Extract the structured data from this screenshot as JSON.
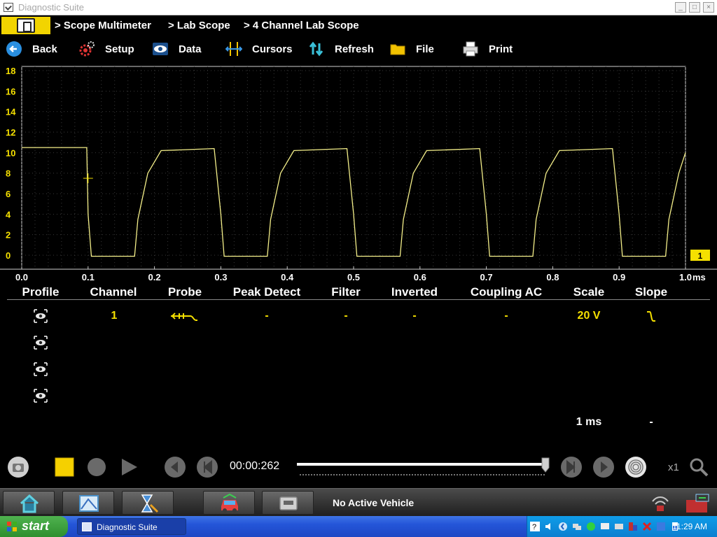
{
  "window": {
    "title": "Diagnostic Suite"
  },
  "breadcrumb": {
    "items": [
      "> Scope Multimeter",
      "> Lab Scope",
      "> 4 Channel Lab Scope"
    ]
  },
  "toolbar": {
    "back": "Back",
    "setup": "Setup",
    "data": "Data",
    "cursors": "Cursors",
    "refresh": "Refresh",
    "file": "File",
    "print": "Print"
  },
  "scope": {
    "y_ticks": [
      "18",
      "16",
      "14",
      "12",
      "10",
      "8",
      "6",
      "4",
      "2",
      "0"
    ],
    "x_ticks": [
      "0.0",
      "0.1",
      "0.2",
      "0.3",
      "0.4",
      "0.5",
      "0.6",
      "0.7",
      "0.8",
      "0.9",
      "1.0"
    ],
    "x_unit": "ms",
    "channel_marker": "1",
    "trace_color": "#f5f08a",
    "marker_color": "#f5e000"
  },
  "chart_data": {
    "type": "line",
    "title": "",
    "xlabel": "ms",
    "ylabel": "",
    "xlim": [
      0,
      1.0
    ],
    "ylim": [
      -1.5,
      18
    ],
    "grid": true,
    "series": [
      {
        "x": [
          0.0,
          0.098,
          0.1,
          0.105,
          0.17,
          0.175,
          0.19,
          0.21,
          0.29,
          0.3,
          0.305,
          0.37,
          0.375,
          0.39,
          0.41,
          0.49,
          0.5,
          0.505,
          0.57,
          0.575,
          0.59,
          0.61,
          0.69,
          0.7,
          0.705,
          0.77,
          0.775,
          0.79,
          0.81,
          0.89,
          0.9,
          0.905,
          0.97,
          0.975,
          0.99,
          1.0
        ],
        "y": [
          10.5,
          10.5,
          4.0,
          -0.1,
          -0.1,
          3.5,
          8.0,
          10.2,
          10.4,
          4.0,
          -0.1,
          -0.1,
          3.5,
          8.0,
          10.2,
          10.4,
          4.0,
          -0.1,
          -0.1,
          3.5,
          8.0,
          10.2,
          10.4,
          4.0,
          -0.1,
          -0.1,
          3.5,
          8.0,
          10.2,
          10.4,
          4.0,
          -0.1,
          -0.1,
          3.5,
          8.0,
          10.0
        ]
      }
    ]
  },
  "channel_table": {
    "headers": [
      "Profile",
      "Channel",
      "Probe",
      "Peak Detect",
      "Filter",
      "Inverted",
      "Coupling AC",
      "Scale",
      "Slope"
    ],
    "row1": {
      "channel": "1",
      "peak_detect": "-",
      "filter": "-",
      "inverted": "-",
      "coupling": "-",
      "scale": "20 V"
    },
    "footer": {
      "time_per_div": "1 ms",
      "slope_dash": "-"
    }
  },
  "playback": {
    "time": "00:00:262",
    "speed": "x1",
    "position": 0.99
  },
  "app_strip": {
    "vehicle_status": "No Active Vehicle"
  },
  "taskbar": {
    "start": "start",
    "task_item": "Diagnostic Suite",
    "clock": "11:29 AM"
  }
}
